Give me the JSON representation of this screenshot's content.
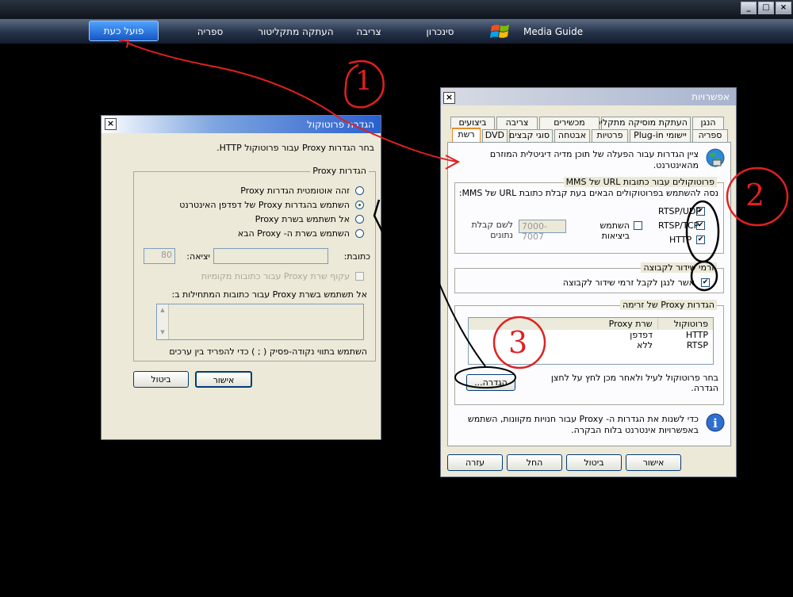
{
  "nav": {
    "tabs": [
      {
        "label": "פועל כעת",
        "active": true
      },
      {
        "label": "ספריה"
      },
      {
        "label": "העתקה מתקליטור"
      },
      {
        "label": "צריבה"
      },
      {
        "label": "סינכרון"
      }
    ],
    "media_guide": "Media Guide"
  },
  "options": {
    "title": "אפשרויות",
    "tabs_row1": [
      "הנגן",
      "העתקת מוסיקה מתקליטור",
      "מכשירים",
      "צריבה",
      "ביצועים"
    ],
    "tabs_row2": [
      "ספריה",
      "יישומי Plug-in",
      "פרטיות",
      "אבטחה",
      "סוגי קבצים",
      "DVD",
      "רשת"
    ],
    "description": "ציין הגדרות עבור הפעלה של תוכן מדיה דיגיטלית המוזרם מהאינטרנט.",
    "mms": {
      "title": "פרוטוקולים עבור כתובות URL של MMS",
      "instruction": "נסה להשתמש בפרוטוקולים הבאים בעת קבלת כתובת URL של MMS:",
      "rtsp_udp": "RTSP/UDP",
      "rtsp_tcp": "RTSP/TCP",
      "http": "HTTP",
      "use_ports": "השתמש ביציאות",
      "ports_value": "7000-7007",
      "receive_data": "לשם קבלת נתונים"
    },
    "multicast": {
      "title": "זרמי שידור לקבוצה",
      "allow": "אשר לנגן לקבל זרמי שידור לקבוצה"
    },
    "proxy": {
      "title": "הגדרות Proxy של זרימה",
      "col_protocol": "פרוטוקול",
      "col_proxy": "שרת Proxy",
      "rows": [
        {
          "protocol": "HTTP",
          "proxy": "דפדפן"
        },
        {
          "protocol": "RTSP",
          "proxy": "ללא"
        }
      ],
      "instruction": "בחר פרוטוקול לעיל ולאחר מכן לחץ על לחצן הגדרה.",
      "settings_button": "הגדרה..."
    },
    "info": "כדי לשנות את הגדרות ה- Proxy עבור חנויות מקוונות, השתמש באפשרויות אינטרנט בלוח הבקרה.",
    "buttons": {
      "ok": "אישור",
      "cancel": "ביטול",
      "apply": "החל",
      "help": "עזרה"
    }
  },
  "protocol": {
    "title": "הגדרת פרוטוקול",
    "description": "בחר הגדרות Proxy עבור פרוטוקול HTTP.",
    "group_title": "הגדרות Proxy",
    "options": [
      {
        "label": "זהה אוטומטית הגדרות Proxy",
        "selected": false
      },
      {
        "label": "השתמש בהגדרות Proxy של דפדפן האינטרנט",
        "selected": true
      },
      {
        "label": "אל תשתמש בשרת Proxy",
        "selected": false
      },
      {
        "label": "השתמש בשרת ה- Proxy הבא",
        "selected": false
      }
    ],
    "address_label": "כתובת:",
    "port_label": "יציאה:",
    "port_value": "80",
    "bypass_local": "עקוף שרת Proxy עבור כתובות מקומיות",
    "exceptions_label": "אל תשתמש בשרת Proxy עבור כתובות המתחילות ב:",
    "separator_hint": "השתמש בתווי נקודה-פסיק ( ; ) כדי להפריד בין ערכים",
    "buttons": {
      "ok": "אישור",
      "cancel": "ביטול"
    }
  },
  "annotations": {
    "one": "1",
    "two": "2",
    "three": "3"
  },
  "colors": {
    "red_marker": "#e02020",
    "title_blue": "#0a246a",
    "nav_active": "#2a78e4"
  }
}
